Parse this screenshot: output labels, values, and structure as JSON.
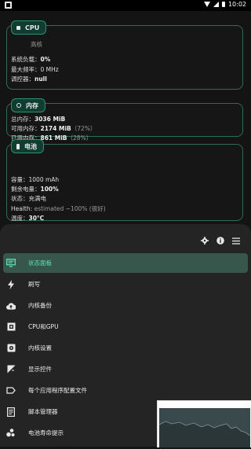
{
  "status_bar": {
    "time": "10:02"
  },
  "cpu": {
    "tag": "CPU",
    "cluster": "高核",
    "lines": [
      {
        "label": "系统负载：",
        "value": "0%"
      },
      {
        "label": "最大频率：",
        "value": "0 MHz"
      },
      {
        "label": "调控器：",
        "value": "null"
      }
    ]
  },
  "memory": {
    "tag": "内存",
    "lines": [
      {
        "label": "总内存：",
        "value": "3036 MiB",
        "extra": ""
      },
      {
        "label": "可用内存：",
        "value": "2174 MiB",
        "extra": "（72%）"
      },
      {
        "label": "已用内存：",
        "value": "861 MiB",
        "extra": "（28%）"
      }
    ]
  },
  "battery": {
    "tag": "电池",
    "lines": [
      {
        "label": "容量：",
        "value": "1000 mAh"
      },
      {
        "label": "剩余电量：",
        "value": "100%"
      },
      {
        "label": "状态：",
        "value": "充满电"
      },
      {
        "label": "Health: ",
        "value": "estimated ~100% (很好)"
      },
      {
        "label": "温度：",
        "value": "30°C"
      }
    ]
  },
  "drawer": {
    "tools": [
      "gear-icon",
      "info-icon",
      "menu-icon"
    ],
    "items": [
      {
        "label": "状态面板",
        "icon": "monitor-icon",
        "active": true
      },
      {
        "label": "刷写",
        "icon": "flash-icon",
        "active": false
      },
      {
        "label": "内核备份",
        "icon": "cloud-upload-icon",
        "active": false
      },
      {
        "label": "CPU和GPU",
        "icon": "chip-icon",
        "active": false
      },
      {
        "label": "内核设置",
        "icon": "settings-box-icon",
        "active": false
      },
      {
        "label": "显示控件",
        "icon": "display-icon",
        "active": false
      },
      {
        "label": "每个应用程序配置文件",
        "icon": "tag-icon",
        "active": false
      },
      {
        "label": "脚本管理器",
        "icon": "script-icon",
        "active": false
      },
      {
        "label": "电池寿命提示",
        "icon": "bubbles-icon",
        "active": false
      }
    ]
  },
  "colors": {
    "accent": "#5fe0b6",
    "active_bg": "#37564c",
    "card_border": "#2e6b58"
  }
}
